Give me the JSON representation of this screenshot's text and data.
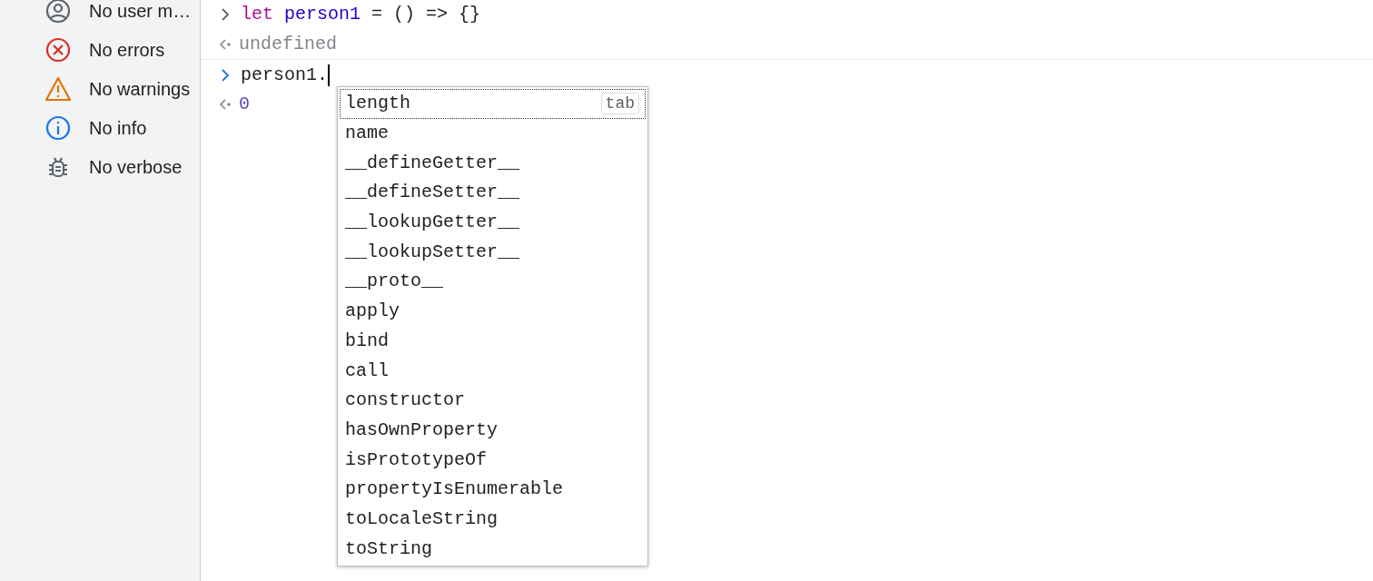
{
  "sidebar": {
    "items": [
      {
        "kind": "user",
        "label": "No user m…"
      },
      {
        "kind": "error",
        "label": "No errors"
      },
      {
        "kind": "warning",
        "label": "No warnings"
      },
      {
        "kind": "info",
        "label": "No info"
      },
      {
        "kind": "verbose",
        "label": "No verbose"
      }
    ]
  },
  "console": {
    "entries": [
      {
        "kind": "input",
        "current": false,
        "tokens": [
          {
            "kind": "keyword",
            "text": "let"
          },
          {
            "kind": "variable",
            "text": "person1"
          },
          {
            "kind": "plain",
            "text": "= () => {}"
          }
        ]
      },
      {
        "kind": "undefined",
        "text": "undefined"
      },
      {
        "kind": "input",
        "current": true,
        "tokens": [
          {
            "kind": "plain",
            "text": "person1."
          }
        ]
      },
      {
        "kind": "number",
        "text": "0"
      }
    ]
  },
  "autocomplete": {
    "items": [
      {
        "label": "length",
        "selected": true,
        "hint": "tab"
      },
      {
        "label": "name",
        "selected": false
      },
      {
        "label": "__defineGetter__",
        "selected": false
      },
      {
        "label": "__defineSetter__",
        "selected": false
      },
      {
        "label": "__lookupGetter__",
        "selected": false
      },
      {
        "label": "__lookupSetter__",
        "selected": false
      },
      {
        "label": "__proto__",
        "selected": false
      },
      {
        "label": "apply",
        "selected": false
      },
      {
        "label": "bind",
        "selected": false
      },
      {
        "label": "call",
        "selected": false
      },
      {
        "label": "constructor",
        "selected": false
      },
      {
        "label": "hasOwnProperty",
        "selected": false
      },
      {
        "label": "isPrototypeOf",
        "selected": false
      },
      {
        "label": "propertyIsEnumerable",
        "selected": false
      },
      {
        "label": "toLocaleString",
        "selected": false
      },
      {
        "label": "toString",
        "selected": false
      }
    ]
  }
}
